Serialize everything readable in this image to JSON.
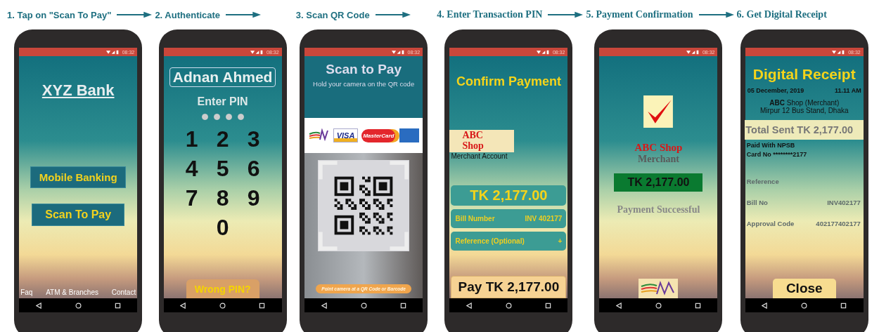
{
  "steps": [
    {
      "title": "1. Tap on \"Scan To Pay\"",
      "screen": {
        "kind": "home",
        "time": "08:32",
        "bank": "XYZ Bank",
        "buttons": [
          "Mobile Banking",
          "Scan To Pay"
        ],
        "footer_links": [
          "Faq",
          "ATM & Branches",
          "Contact"
        ]
      }
    },
    {
      "title": "2. Authenticate",
      "screen": {
        "kind": "pin",
        "time": "08:32",
        "name": "Adnan Ahmed",
        "prompt": "Enter PIN",
        "pin_dots": [
          {
            "filled": true
          },
          {
            "filled": true
          },
          {
            "filled": true
          },
          {
            "filled": true
          }
        ],
        "keys": [
          "1",
          "2",
          "3",
          "4",
          "5",
          "6",
          "7",
          "8",
          "9",
          "0"
        ],
        "link": "Wrong PIN?"
      }
    },
    {
      "title": "3. Scan QR Code",
      "screen": {
        "kind": "scan",
        "time": "08:32",
        "heading": "Scan to Pay",
        "subheading": "Hold your camera on the QR code",
        "card_logos": [
          {
            "kind": "npsb"
          },
          {
            "kind": "visa",
            "text": "VISA"
          },
          {
            "kind": "mastercard",
            "text": "MasterCard"
          },
          {
            "kind": "amex"
          }
        ],
        "hint": "Point camera at a QR Code or Barcode"
      }
    },
    {
      "title": "4. Enter Transaction PIN",
      "screen": {
        "kind": "confirm",
        "time": "08:32",
        "heading": "Confirm Payment",
        "merchant": "ABC Shop",
        "merchant_label": "Merchant Account",
        "amount": "TK 2,177.00",
        "fields": [
          {
            "label": "Bill Number",
            "value": "INV 402177"
          },
          {
            "label": "Reference (Optional)",
            "value": "+"
          }
        ],
        "pay_button": "Pay TK 2,177.00"
      }
    },
    {
      "title": "5. Payment Confirmation",
      "screen": {
        "kind": "success",
        "time": "08:32",
        "merchant": "ABC Shop",
        "merchant_label": "Merchant",
        "amount": "TK 2,177.00",
        "status": "Payment Successful"
      }
    },
    {
      "title": "6. Get Digital Receipt",
      "screen": {
        "kind": "receipt",
        "time": "08:32",
        "heading": "Digital Receipt",
        "date": "05 December, 2019",
        "time_of_day": "11.11 AM",
        "merchant_line": "**ABC** Shop (Merchant)",
        "address": "Mirpur 12 Bus Stand, Dhaka",
        "total": "Total Sent TK 2,177.00",
        "paid_with": "Paid With NPSB",
        "card": "Card No ********2177",
        "rows": [
          {
            "label": "Reference"
          },
          {
            "label": "Bill No",
            "value": "INV402177"
          },
          {
            "label": "Approval Code",
            "value": "402177402177"
          }
        ],
        "close_button": "Close"
      }
    }
  ]
}
